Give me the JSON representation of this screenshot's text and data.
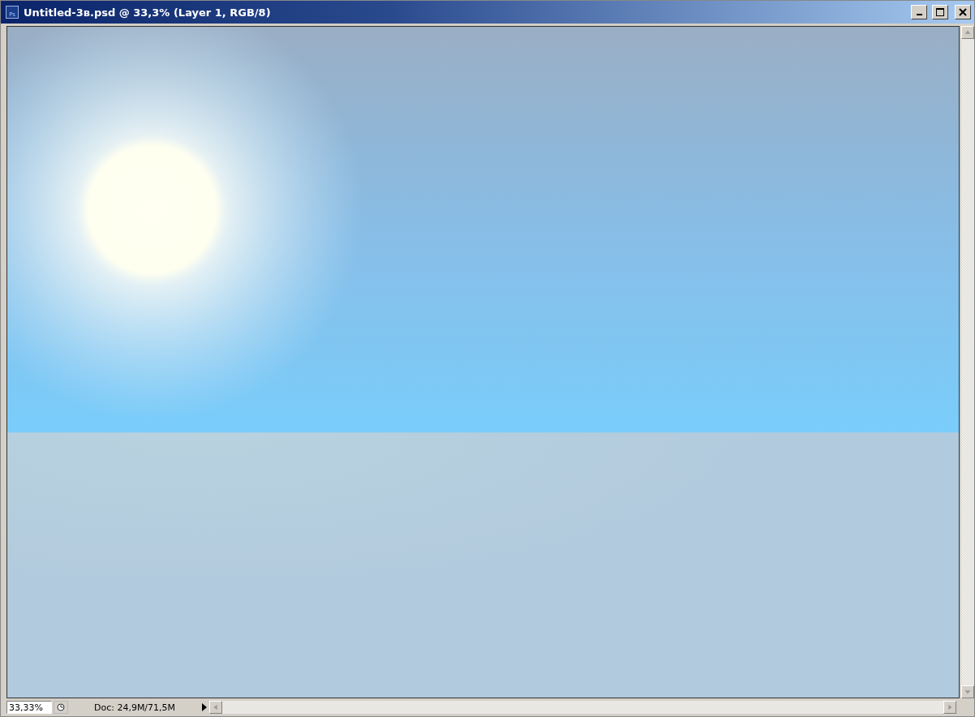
{
  "window": {
    "title": "Untitled-3в.psd @ 33,3% (Layer 1, RGB/8)",
    "app_badge": "Ps"
  },
  "status_bar": {
    "zoom": "33,33%",
    "doc_info": "Doc: 24,9M/71,5M"
  }
}
